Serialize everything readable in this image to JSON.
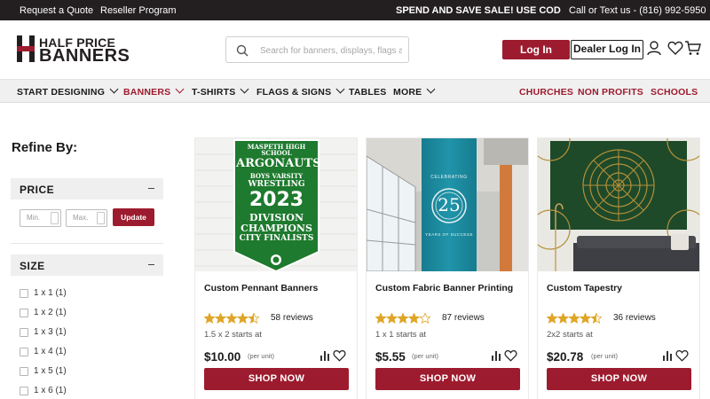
{
  "topbar": {
    "request_quote": "Request a Quote",
    "reseller": "Reseller Program",
    "promo": "SPEND AND SAVE SALE! USE CODE: SPEN",
    "phone": "Call or Text us - (816) 992-5950"
  },
  "header": {
    "logo_line1": "HALF PRICE",
    "logo_line2": "BANNERS",
    "search_placeholder": "Search for banners, displays, flags and more",
    "login": "Log In",
    "dealer_login": "Dealer Log In",
    "icons": [
      "user-icon",
      "heart-icon",
      "cart-icon"
    ]
  },
  "nav": {
    "items": [
      {
        "label": "START DESIGNING",
        "dropdown": true
      },
      {
        "label": "BANNERS",
        "dropdown": true,
        "active": true
      },
      {
        "label": "T-SHIRTS",
        "dropdown": true
      },
      {
        "label": "FLAGS & SIGNS",
        "dropdown": true
      },
      {
        "label": "TABLES",
        "dropdown": false
      },
      {
        "label": "MORE",
        "dropdown": true
      }
    ],
    "right_links": [
      "CHURCHES",
      "NON PROFITS",
      "SCHOOLS"
    ]
  },
  "sidebar": {
    "title": "Refine By:",
    "price": {
      "heading": "PRICE",
      "min_placeholder": "Min.",
      "max_placeholder": "Max.",
      "update": "Update"
    },
    "size": {
      "heading": "SIZE",
      "options": [
        "1 x 1 (1)",
        "1 x 2 (1)",
        "1 x 3 (1)",
        "1 x 4 (1)",
        "1 x 5 (1)",
        "1 x 6 (1)"
      ]
    }
  },
  "products": [
    {
      "name": "Custom Pennant Banners",
      "rating": 4.5,
      "reviews": "58 reviews",
      "starts_at": "1.5 x 2 starts at",
      "price": "$10.00",
      "unit": "(per unit)",
      "cta": "SHOP NOW",
      "image_text": {
        "line1": "MASPETH HIGH SCHOOL",
        "line2": "ARGONAUTS",
        "line3": "BOYS VARSITY",
        "line4": "WRESTLING",
        "line5": "2023",
        "line6": "DIVISION",
        "line7": "CHAMPIONS",
        "line8": "CITY FINALISTS"
      }
    },
    {
      "name": "Custom Fabric Banner Printing",
      "rating": 4.0,
      "reviews": "87 reviews",
      "starts_at": "1 x 1 starts at",
      "price": "$5.55",
      "unit": "(per unit)",
      "cta": "SHOP NOW",
      "image_text": {
        "top": "CELEBRATING",
        "number": "25",
        "bottom": "YEARS OF SUCCESS"
      }
    },
    {
      "name": "Custom Tapestry",
      "rating": 4.5,
      "reviews": "36 reviews",
      "starts_at": "2x2 starts at",
      "price": "$20.78",
      "unit": "(per unit)",
      "cta": "SHOP NOW"
    }
  ],
  "colors": {
    "brand_red": "#9d1b2e",
    "star": "#e0a526",
    "dark": "#231f20"
  }
}
